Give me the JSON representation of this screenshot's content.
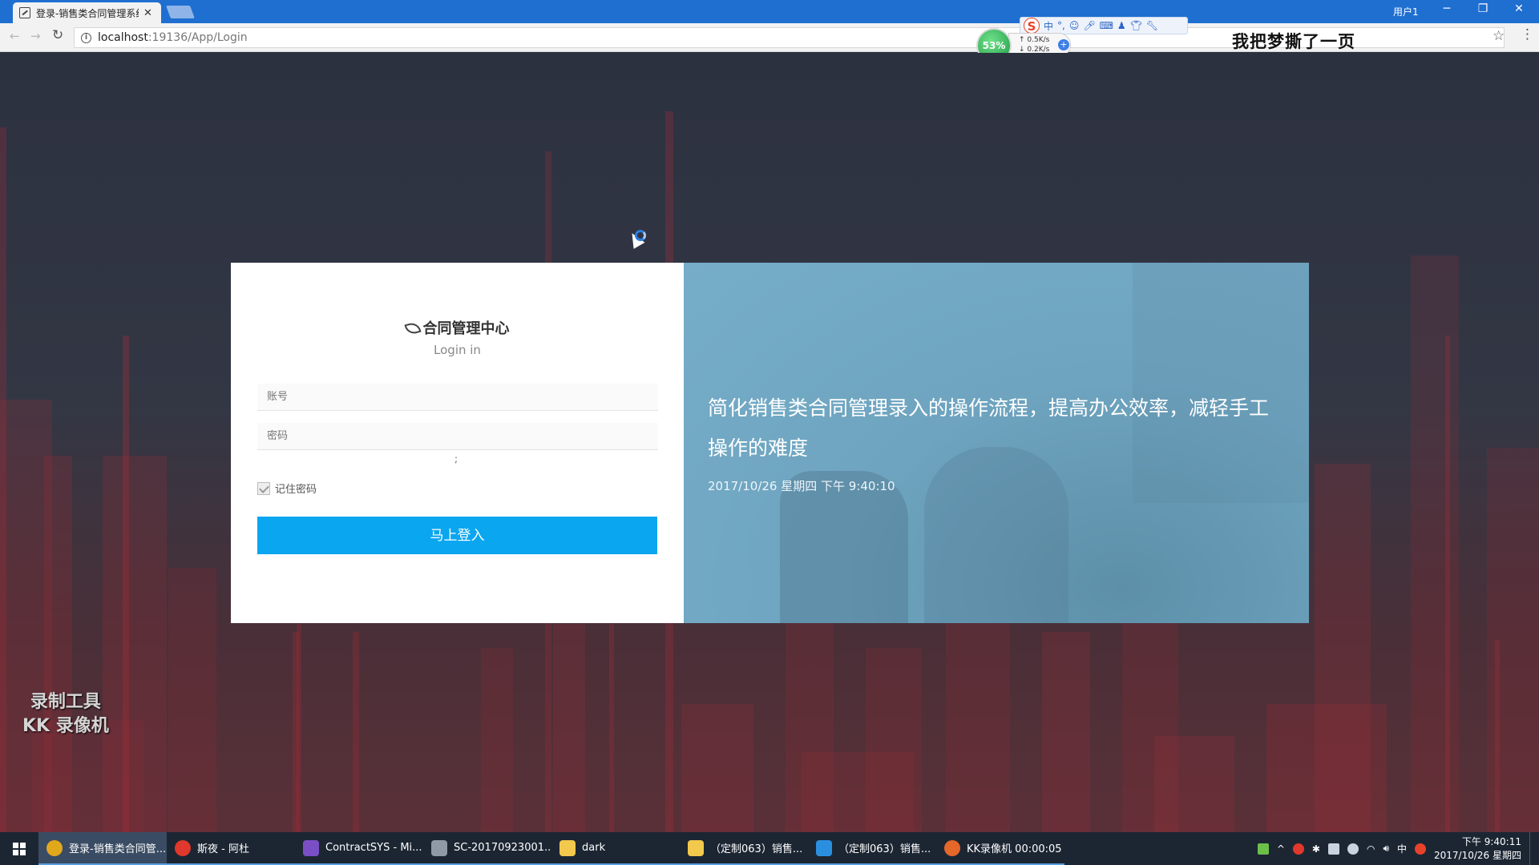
{
  "browser": {
    "tab_title": "登录-销售类合同管理系统",
    "tab_close": "✕",
    "user_label": "用户1",
    "url_host": "localhost",
    "url_rest": ":19136/App/Login",
    "window_controls": [
      "─",
      "❐",
      "✕"
    ]
  },
  "overlays": {
    "ime_label": "中",
    "monitor_percent": "53%",
    "upload_speed": "↑ 0.5K/s",
    "download_speed": "↓ 0.2K/s",
    "monitor_plus": "+",
    "watermark_top": "我把梦撕了一页",
    "kk_line1": "录制工具",
    "kk_line2": "KK 录像机"
  },
  "login": {
    "brand": "合同管理中心",
    "subtitle": "Login in",
    "account_placeholder": "账号",
    "password_placeholder": "密码",
    "small_mark": ";",
    "remember_label": "记住密码",
    "remember_checked": true,
    "submit_label": "马上登入",
    "accent_color": "#0aa6f0"
  },
  "hero": {
    "slogan": "简化销售类合同管理录入的操作流程，提高办公效率，减轻手工操作的难度",
    "datetime": "2017/10/26 星期四 下午 9:40:10"
  },
  "taskbar": {
    "items": [
      {
        "label": "登录-销售类合同管...",
        "icon": "chrome-icon",
        "color": "#e2a81c",
        "active": true
      },
      {
        "label": "斯夜 - 阿杜",
        "icon": "music-icon",
        "color": "#e0382c",
        "active": false
      },
      {
        "label": "ContractSYS - Mi...",
        "icon": "visual-studio-icon",
        "color": "#7a4fc6",
        "active": false
      },
      {
        "label": "SC-20170923001...",
        "icon": "tool-icon",
        "color": "#8f9aa6",
        "active": false
      },
      {
        "label": "dark",
        "icon": "folder-icon",
        "color": "#f2c94c",
        "active": false
      },
      {
        "label": "（定制063）销售...",
        "icon": "folder-icon",
        "color": "#f2c94c",
        "active": false
      },
      {
        "label": "（定制063）销售...",
        "icon": "word-icon",
        "color": "#2b8fe0",
        "active": false
      },
      {
        "label": "KK录像机 00:00:05",
        "icon": "recorder-icon",
        "color": "#e5672a",
        "active": false
      }
    ],
    "tray_ime": "中",
    "clock_time": "下午 9:40:11",
    "clock_date": "2017/10/26 星期四"
  }
}
